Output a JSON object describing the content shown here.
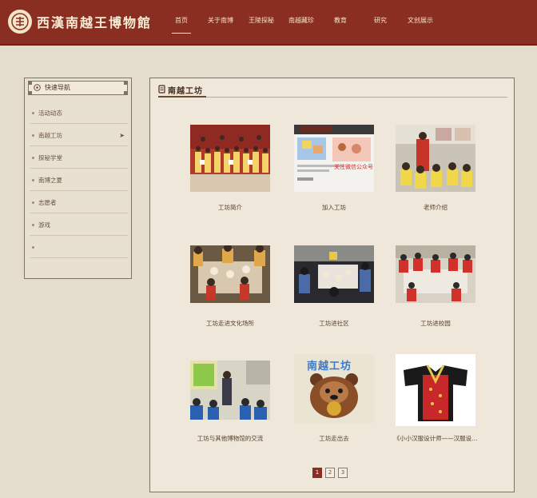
{
  "header": {
    "logo_text": "西漢南越王博物館",
    "nav": [
      {
        "label": "首页",
        "active": true
      },
      {
        "label": "关于南博",
        "active": false
      },
      {
        "label": "王陵探秘",
        "active": false
      },
      {
        "label": "南越藏珍",
        "active": false
      },
      {
        "label": "教育",
        "active": false
      },
      {
        "label": "研究",
        "active": false
      },
      {
        "label": "文创展示",
        "active": false
      }
    ]
  },
  "sidebar": {
    "title": "快速导航",
    "items": [
      {
        "label": "活动动态"
      },
      {
        "label": "南越工坊",
        "active": true
      },
      {
        "label": "探秘学堂"
      },
      {
        "label": "南博之夏"
      },
      {
        "label": "志愿者"
      },
      {
        "label": "游戏"
      }
    ]
  },
  "main": {
    "title": "南越工坊",
    "cards": [
      {
        "caption": "工坊简介",
        "icon": "group-photo"
      },
      {
        "caption": "加入工坊",
        "icon": "wechat-screenshot"
      },
      {
        "caption": "老师介绍",
        "icon": "teacher-photo"
      },
      {
        "caption": "工坊走进文化场所",
        "icon": "workshop-photo"
      },
      {
        "caption": "工坊进社区",
        "icon": "community-photo"
      },
      {
        "caption": "工坊进校园",
        "icon": "school-photo"
      },
      {
        "caption": "工坊与其他博物馆的交流",
        "icon": "exchange-photo"
      },
      {
        "caption": "工坊走出去",
        "icon": "bear-logo"
      },
      {
        "caption": "《小小汉服设计师——汉服设...",
        "icon": "hanfu-photo"
      }
    ],
    "wechat_overlay_text": "关注微信公众号",
    "bear_text": "南越工坊",
    "pagination": [
      "1",
      "2",
      "3"
    ],
    "current_page": "1"
  },
  "colors": {
    "header_bg": "#8b2e22",
    "page_bg": "#e4dccc",
    "panel_bg": "#eee7da",
    "accent": "#8b2e22"
  }
}
